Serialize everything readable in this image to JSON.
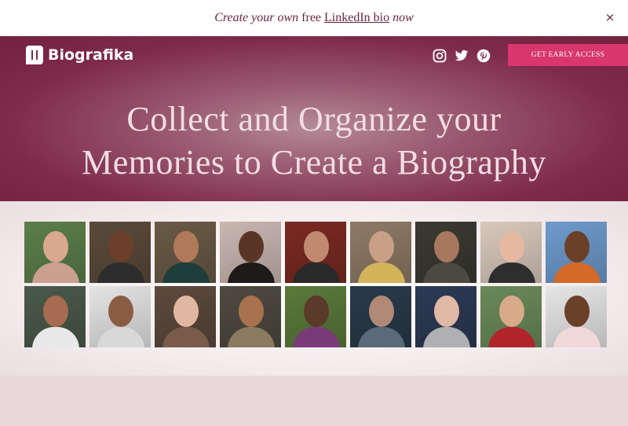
{
  "announcement": {
    "prefix": "Create your own",
    "middle": "free",
    "link": "LinkedIn bio",
    "suffix": "now",
    "close": "×"
  },
  "brand": {
    "name": "Biografika"
  },
  "social": [
    {
      "name": "instagram-icon"
    },
    {
      "name": "twitter-icon"
    },
    {
      "name": "pinterest-icon"
    }
  ],
  "cta": {
    "label": "GET EARLY ACCESS"
  },
  "hero": {
    "line1": "Collect and Organize your",
    "line2": "Memories to Create a Biography"
  },
  "colors": {
    "brand": "#7e2a4a",
    "accent": "#d8366d",
    "announcement_text": "#6b2340"
  },
  "portraits": [
    {
      "bg": "#5b7f4a",
      "skin": "#d9a88e",
      "shirt": "#caa08e"
    },
    {
      "bg": "#5a4a3a",
      "skin": "#6b3f2a",
      "shirt": "#2d2d2d"
    },
    {
      "bg": "#6a5a46",
      "skin": "#b07a5a",
      "shirt": "#1f3d3a"
    },
    {
      "bg": "#c9b7b0",
      "skin": "#5a3525",
      "shirt": "#1e1a1a"
    },
    {
      "bg": "#7a2a22",
      "skin": "#c08a70",
      "shirt": "#2a2a2a"
    },
    {
      "bg": "#8e7a66",
      "skin": "#c9a086",
      "shirt": "#d4b45a"
    },
    {
      "bg": "#3a3a32",
      "skin": "#a8785e",
      "shirt": "#4a4a40"
    },
    {
      "bg": "#d8c8bc",
      "skin": "#e4b9a0",
      "shirt": "#2e2e2e"
    },
    {
      "bg": "#6e9acb",
      "skin": "#6b4028",
      "shirt": "#d36a2a"
    },
    {
      "bg": "#4a5a4a",
      "skin": "#a86a50",
      "shirt": "#e8e8e8"
    },
    {
      "bg": "#e4e4e4",
      "skin": "#8a5c42",
      "shirt": "#d8d8d8"
    },
    {
      "bg": "#5c4a3c",
      "skin": "#e0b8a2",
      "shirt": "#7a5a48"
    },
    {
      "bg": "#4e4a40",
      "skin": "#a8724e",
      "shirt": "#8a7a60"
    },
    {
      "bg": "#5a7a3a",
      "skin": "#5a3a28",
      "shirt": "#7a3a7a"
    },
    {
      "bg": "#2a3a4a",
      "skin": "#b08a76",
      "shirt": "#5a6a7a"
    },
    {
      "bg": "#2c3a55",
      "skin": "#e0b8a6",
      "shirt": "#b0b0b4"
    },
    {
      "bg": "#6a8a5a",
      "skin": "#d9aa8a",
      "shirt": "#b0242a"
    },
    {
      "bg": "#e6e6e6",
      "skin": "#6a4028",
      "shirt": "#f2d8d8"
    }
  ]
}
